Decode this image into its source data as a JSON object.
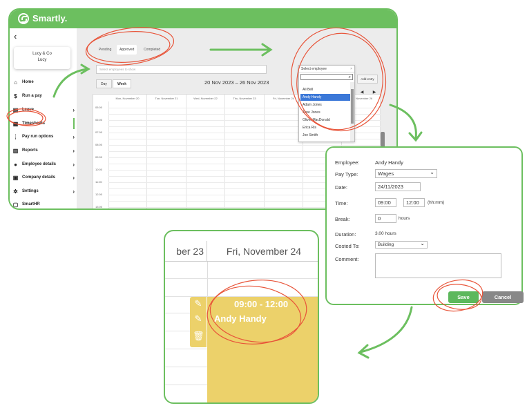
{
  "app": {
    "name": "Smartly."
  },
  "company": {
    "name": "Lucy & Co",
    "user": "Lucy"
  },
  "sidebar": {
    "items": [
      {
        "label": "Home",
        "icon": "home-icon"
      },
      {
        "label": "Run a pay",
        "icon": "dollar-icon"
      },
      {
        "label": "Leave",
        "icon": "calendar-icon"
      },
      {
        "label": "Timesheets",
        "icon": "timesheet-icon"
      },
      {
        "label": "Pay run options",
        "icon": "grid-icon"
      },
      {
        "label": "Reports",
        "icon": "reports-icon"
      },
      {
        "label": "Employee details",
        "icon": "person-icon"
      },
      {
        "label": "Company details",
        "icon": "building-icon"
      },
      {
        "label": "Settings",
        "icon": "gear-icon"
      },
      {
        "label": "SmartHR",
        "icon": "hr-icon"
      }
    ]
  },
  "tabs": [
    "Pending",
    "Approved",
    "Completed"
  ],
  "search": {
    "placeholder": "Select employees to show"
  },
  "view": {
    "day": "Day",
    "week": "Week"
  },
  "date_range": "20 Nov 2023 – 26 Nov 2023",
  "add_entry": "Add entry",
  "calendar": {
    "columns": [
      "Mon, November 20",
      "Tue, November 21",
      "Wed, November 22",
      "Thu, November 23",
      "Fri, November 24",
      "",
      "Sun, November 26"
    ],
    "times": [
      "05:00",
      "06:00",
      "07:00",
      "08:00",
      "09:00",
      "10:00",
      "11:00",
      "12:00",
      "13:00"
    ]
  },
  "employee_dropdown": {
    "label": "Select employee",
    "options": [
      "Ali Bell",
      "Andy Handy",
      "Adam Jones",
      "Jane Jones",
      "Oliver MacDonald",
      "Erica Ris",
      "Joe Smith"
    ],
    "highlighted": "Andy Handy"
  },
  "dialog": {
    "employee_label": "Employee:",
    "employee_value": "Andy Handy",
    "pay_type_label": "Pay Type:",
    "pay_type_value": "Wages",
    "date_label": "Date:",
    "date_value": "24/11/2023",
    "time_label": "Time:",
    "time_start": "09:00",
    "time_end": "12:00",
    "time_format": "(hh:mm)",
    "break_label": "Break:",
    "break_value": "0",
    "break_unit": "hours",
    "duration_label": "Duration:",
    "duration_value": "3.00 hours",
    "costed_label": "Costed To:",
    "costed_value": "Building",
    "comment_label": "Comment:",
    "save": "Save",
    "cancel": "Cancel"
  },
  "zoom": {
    "prev_day": "ber 23",
    "day": "Fri, November 24",
    "shift_time": "09:00 - 12:00",
    "shift_name": "Andy Handy"
  },
  "colors": {
    "brand": "#6cbf5f",
    "shift": "#ecd16a",
    "annotation": "#e8553a",
    "highlight": "#3b78d8"
  }
}
